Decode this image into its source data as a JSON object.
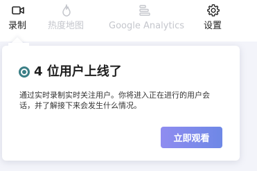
{
  "nav": {
    "items": [
      {
        "label": "录制",
        "icon": "video-camera-icon",
        "state": "active"
      },
      {
        "label": "热度地图",
        "icon": "flame-icon",
        "state": "disabled"
      },
      {
        "label": "Google Analytics",
        "icon": "bar-stack-icon",
        "state": "disabled"
      },
      {
        "label": "设置",
        "icon": "gear-icon",
        "state": "enabled"
      }
    ]
  },
  "popover": {
    "title": "4 位用户上线了",
    "description": "通过实时录制实时关注用户。你将进入正在进行的用户会话，并了解接下来会发生什么情况。",
    "cta_label": "立即观看"
  },
  "colors": {
    "status_teal": "#3b7f86",
    "cta_gradient_start": "#8f8cf0",
    "cta_gradient_end": "#6e88e6",
    "muted_nav": "#c4c6cc"
  }
}
